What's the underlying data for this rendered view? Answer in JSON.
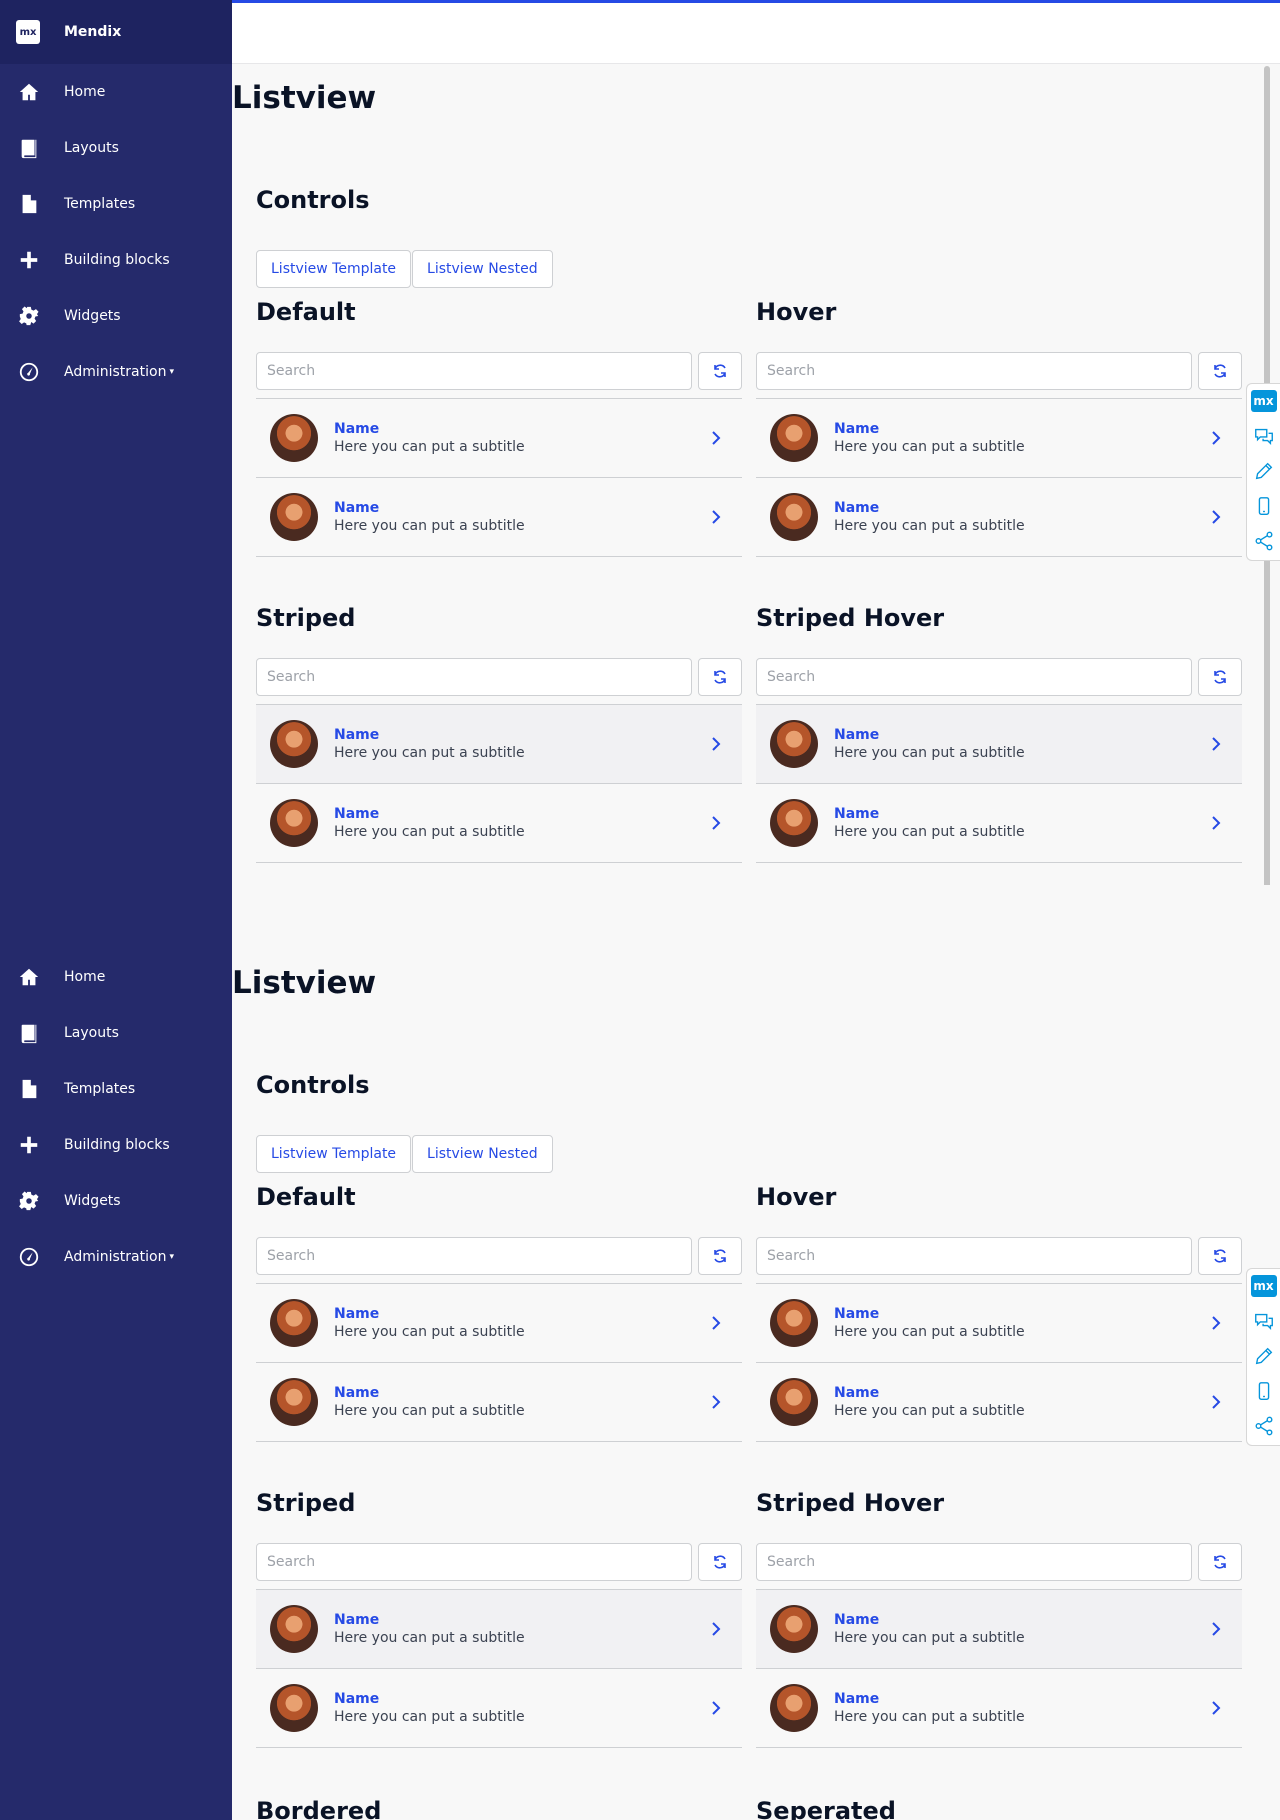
{
  "brand": {
    "logo": "mx",
    "name": "Mendix"
  },
  "nav": [
    {
      "label": "Home",
      "icon": "home-icon"
    },
    {
      "label": "Layouts",
      "icon": "book-icon"
    },
    {
      "label": "Templates",
      "icon": "file-icon"
    },
    {
      "label": "Building blocks",
      "icon": "plus-icon"
    },
    {
      "label": "Widgets",
      "icon": "gear-icon"
    },
    {
      "label": "Administration",
      "icon": "dashboard-icon",
      "caret": "▾"
    }
  ],
  "page": {
    "title": "Listview",
    "controls_heading": "Controls",
    "buttons": [
      "Listview Template",
      "Listview Nested"
    ]
  },
  "blocks": {
    "default": "Default",
    "hover": "Hover",
    "striped": "Striped",
    "striped_hover": "Striped Hover",
    "bordered": "Bordered",
    "seperated": "Seperated"
  },
  "search_placeholder": "Search",
  "item": {
    "name": "Name",
    "subtitle": "Here you can put a subtitle"
  },
  "devtools": {
    "logo": "mx",
    "icons": [
      "chat-icon",
      "pencil-icon",
      "mobile-icon",
      "share-icon"
    ]
  },
  "colors": {
    "sidebar": "#252a6b",
    "accent": "#264ae5",
    "devtools": "#0595db"
  }
}
